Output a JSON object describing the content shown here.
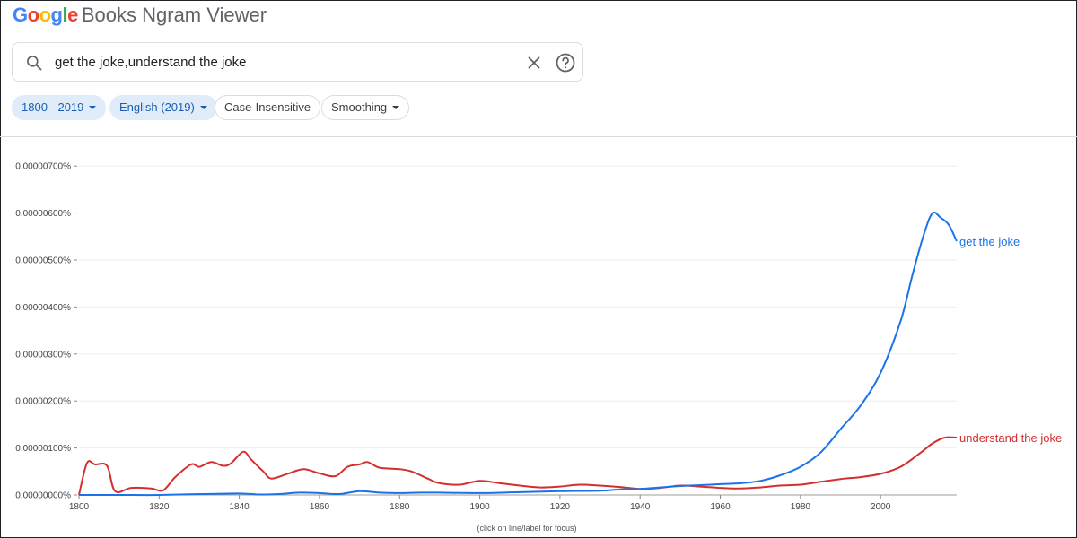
{
  "header": {
    "logo_word": "Google",
    "logo_rest": "Books Ngram Viewer"
  },
  "search": {
    "query": "get the joke,understand the joke",
    "icons": [
      "search-icon",
      "close-icon",
      "help-icon"
    ]
  },
  "filters": {
    "year_range": "1800 - 2019",
    "corpus": "English (2019)",
    "case": "Case-Insensitive",
    "smoothing": "Smoothing"
  },
  "colors": {
    "get_the_joke": "#1a73e8",
    "understand_the_joke": "#d32f2f",
    "chip_blue": "#1a5fb4",
    "chip_bg": "#e1ecfa"
  },
  "chart_data": {
    "type": "line",
    "xlim": [
      1800,
      2019
    ],
    "ylim": [
      0,
      7.5e-06
    ],
    "x_ticks": [
      1800,
      1820,
      1840,
      1860,
      1880,
      1900,
      1920,
      1940,
      1960,
      1980,
      2000
    ],
    "y_ticks": [
      {
        "value": 0.0,
        "label": "0.00000000%"
      },
      {
        "value": 1e-06,
        "label": "0.00000100%"
      },
      {
        "value": 2e-06,
        "label": "0.00000200%"
      },
      {
        "value": 3e-06,
        "label": "0.00000300%"
      },
      {
        "value": 4e-06,
        "label": "0.00000400%"
      },
      {
        "value": 5e-06,
        "label": "0.00000500%"
      },
      {
        "value": 6e-06,
        "label": "0.00000600%"
      },
      {
        "value": 7e-06,
        "label": "0.00000700%"
      }
    ],
    "grid": true,
    "footnote": "(click on line/label for focus)",
    "series": [
      {
        "name": "get the joke",
        "color": "#1a73e8",
        "points": [
          [
            1800,
            0.0
          ],
          [
            1810,
            0.0
          ],
          [
            1820,
            0.0
          ],
          [
            1830,
            2e-08
          ],
          [
            1840,
            3e-08
          ],
          [
            1845,
            1e-08
          ],
          [
            1850,
            2e-08
          ],
          [
            1855,
            5e-08
          ],
          [
            1860,
            4e-08
          ],
          [
            1865,
            2e-08
          ],
          [
            1870,
            8e-08
          ],
          [
            1875,
            5e-08
          ],
          [
            1880,
            4e-08
          ],
          [
            1885,
            5e-08
          ],
          [
            1890,
            5e-08
          ],
          [
            1900,
            4e-08
          ],
          [
            1910,
            6e-08
          ],
          [
            1920,
            8e-08
          ],
          [
            1930,
            9e-08
          ],
          [
            1935,
            1.2e-07
          ],
          [
            1940,
            1.3e-07
          ],
          [
            1945,
            1.6e-07
          ],
          [
            1950,
            1.9e-07
          ],
          [
            1955,
            2.1e-07
          ],
          [
            1960,
            2.3e-07
          ],
          [
            1965,
            2.5e-07
          ],
          [
            1970,
            3e-07
          ],
          [
            1975,
            4.2e-07
          ],
          [
            1980,
            6e-07
          ],
          [
            1985,
            9e-07
          ],
          [
            1990,
            1.4e-06
          ],
          [
            1995,
            1.9e-06
          ],
          [
            2000,
            2.6e-06
          ],
          [
            2005,
            3.7e-06
          ],
          [
            2008,
            4.7e-06
          ],
          [
            2011,
            5.6e-06
          ],
          [
            2013,
            6e-06
          ],
          [
            2015,
            5.9e-06
          ],
          [
            2017,
            5.75e-06
          ],
          [
            2019,
            5.4e-06
          ]
        ]
      },
      {
        "name": "understand the joke",
        "color": "#d32f2f",
        "points": [
          [
            1800,
            0.0
          ],
          [
            1802,
            6.8e-07
          ],
          [
            1804,
            6.5e-07
          ],
          [
            1807,
            6.2e-07
          ],
          [
            1809,
            8e-08
          ],
          [
            1813,
            1.5e-07
          ],
          [
            1818,
            1.4e-07
          ],
          [
            1821,
            1e-07
          ],
          [
            1824,
            3.8e-07
          ],
          [
            1828,
            6.5e-07
          ],
          [
            1830,
            6e-07
          ],
          [
            1833,
            7e-07
          ],
          [
            1836,
            6.2e-07
          ],
          [
            1838,
            6.8e-07
          ],
          [
            1841,
            9.2e-07
          ],
          [
            1843,
            7.5e-07
          ],
          [
            1846,
            5e-07
          ],
          [
            1848,
            3.5e-07
          ],
          [
            1852,
            4.5e-07
          ],
          [
            1856,
            5.5e-07
          ],
          [
            1860,
            4.6e-07
          ],
          [
            1864,
            4e-07
          ],
          [
            1867,
            6e-07
          ],
          [
            1870,
            6.5e-07
          ],
          [
            1872,
            7e-07
          ],
          [
            1875,
            5.8e-07
          ],
          [
            1880,
            5.5e-07
          ],
          [
            1883,
            5e-07
          ],
          [
            1887,
            3.5e-07
          ],
          [
            1890,
            2.5e-07
          ],
          [
            1895,
            2.2e-07
          ],
          [
            1900,
            3e-07
          ],
          [
            1905,
            2.5e-07
          ],
          [
            1910,
            2e-07
          ],
          [
            1915,
            1.6e-07
          ],
          [
            1920,
            1.8e-07
          ],
          [
            1925,
            2.2e-07
          ],
          [
            1930,
            2e-07
          ],
          [
            1935,
            1.7e-07
          ],
          [
            1940,
            1.3e-07
          ],
          [
            1945,
            1.5e-07
          ],
          [
            1950,
            2e-07
          ],
          [
            1955,
            1.8e-07
          ],
          [
            1960,
            1.5e-07
          ],
          [
            1965,
            1.4e-07
          ],
          [
            1970,
            1.6e-07
          ],
          [
            1975,
            2e-07
          ],
          [
            1980,
            2.2e-07
          ],
          [
            1985,
            2.8e-07
          ],
          [
            1990,
            3.4e-07
          ],
          [
            1995,
            3.8e-07
          ],
          [
            2000,
            4.5e-07
          ],
          [
            2005,
            6e-07
          ],
          [
            2010,
            9e-07
          ],
          [
            2013,
            1.1e-06
          ],
          [
            2016,
            1.22e-06
          ],
          [
            2019,
            1.22e-06
          ]
        ]
      }
    ]
  }
}
